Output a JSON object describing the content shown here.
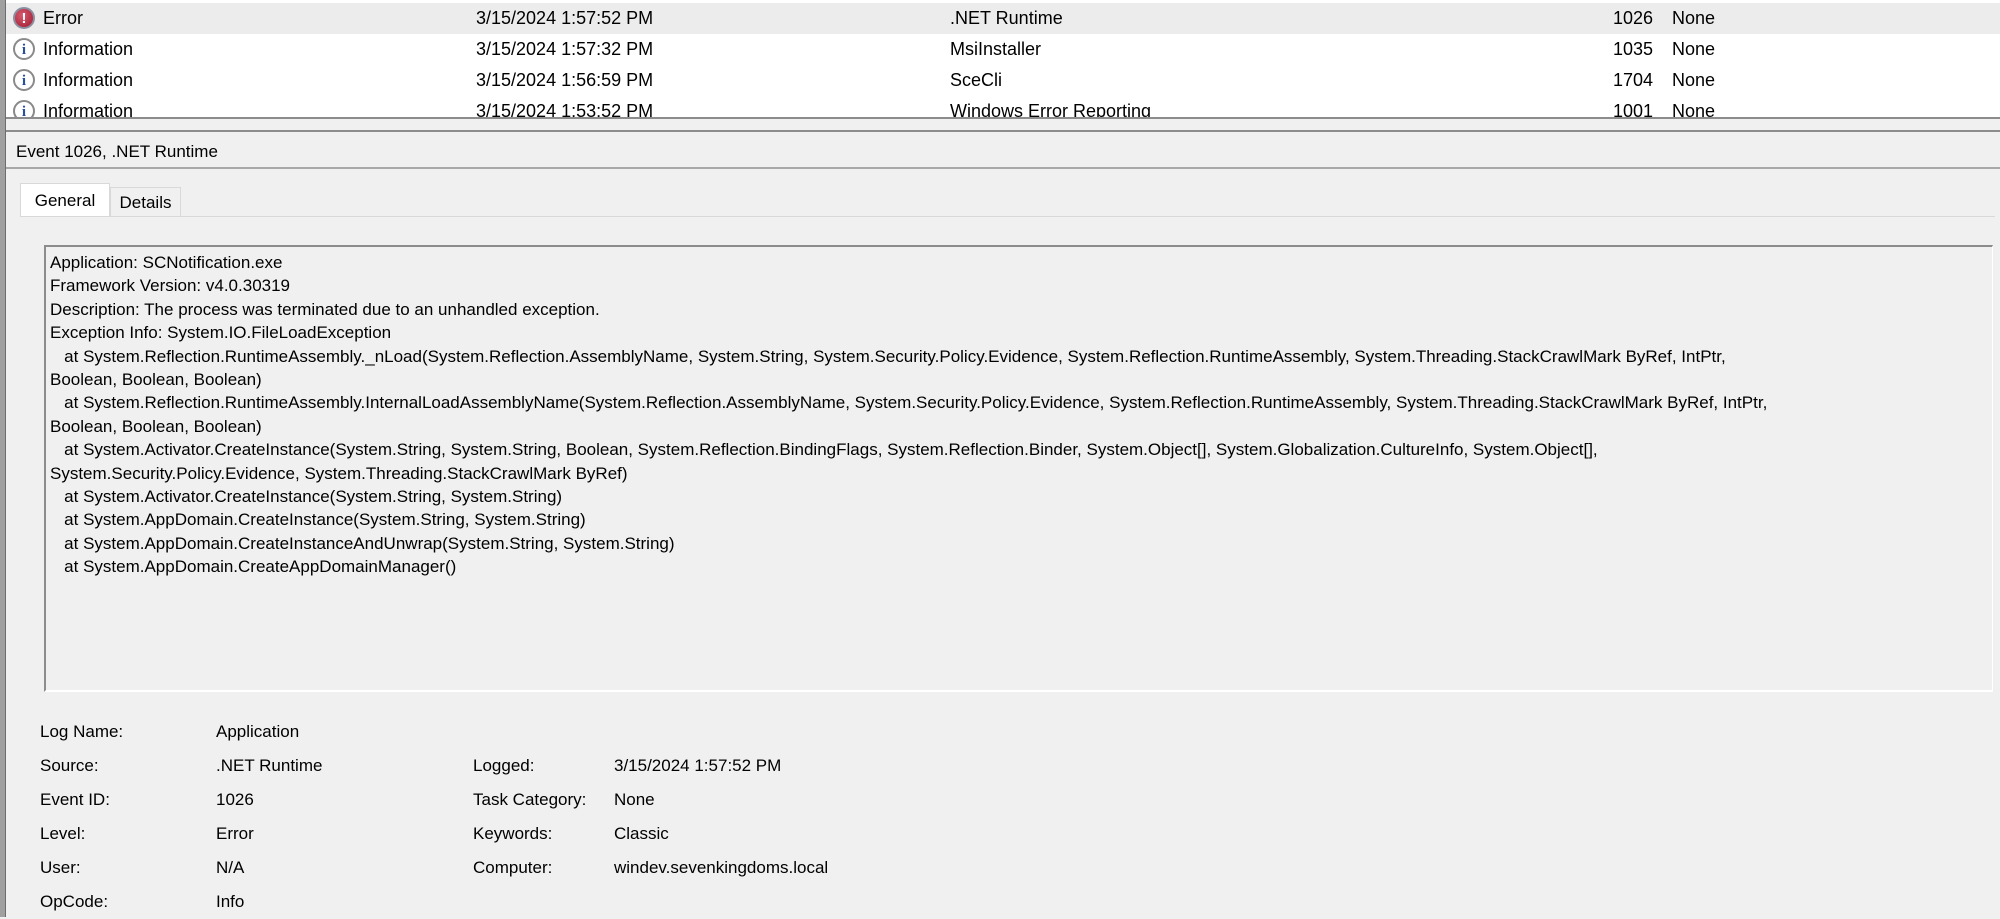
{
  "events": [
    {
      "level": "Error",
      "icon": "error-icon",
      "date": "3/15/2024 1:57:52 PM",
      "source": ".NET Runtime",
      "event_id": "1026",
      "task": "None",
      "selected": true
    },
    {
      "level": "Information",
      "icon": "info-icon",
      "date": "3/15/2024 1:57:32 PM",
      "source": "MsiInstaller",
      "event_id": "1035",
      "task": "None"
    },
    {
      "level": "Information",
      "icon": "info-icon",
      "date": "3/15/2024 1:56:59 PM",
      "source": "SceCli",
      "event_id": "1704",
      "task": "None"
    },
    {
      "level": "Information",
      "icon": "info-icon",
      "date": "3/15/2024 1:53:52 PM",
      "source": "Windows Error Reporting",
      "event_id": "1001",
      "task": "None"
    }
  ],
  "detail": {
    "title": "Event 1026, .NET Runtime",
    "tabs": [
      "General",
      "Details"
    ],
    "active_tab": "General",
    "message_lines": [
      "Application: SCNotification.exe",
      "Framework Version: v4.0.30319",
      "Description: The process was terminated due to an unhandled exception.",
      "Exception Info: System.IO.FileLoadException",
      "   at System.Reflection.RuntimeAssembly._nLoad(System.Reflection.AssemblyName, System.String, System.Security.Policy.Evidence, System.Reflection.RuntimeAssembly, System.Threading.StackCrawlMark ByRef, IntPtr,",
      "Boolean, Boolean, Boolean)",
      "   at System.Reflection.RuntimeAssembly.InternalLoadAssemblyName(System.Reflection.AssemblyName, System.Security.Policy.Evidence, System.Reflection.RuntimeAssembly, System.Threading.StackCrawlMark ByRef, IntPtr,",
      "Boolean, Boolean, Boolean)",
      "   at System.Activator.CreateInstance(System.String, System.String, Boolean, System.Reflection.BindingFlags, System.Reflection.Binder, System.Object[], System.Globalization.CultureInfo, System.Object[],",
      "System.Security.Policy.Evidence, System.Threading.StackCrawlMark ByRef)",
      "   at System.Activator.CreateInstance(System.String, System.String)",
      "   at System.AppDomain.CreateInstance(System.String, System.String)",
      "   at System.AppDomain.CreateInstanceAndUnwrap(System.String, System.String)",
      "   at System.AppDomain.CreateAppDomainManager()"
    ],
    "fields": {
      "log_name_label": "Log Name:",
      "log_name": "Application",
      "source_label": "Source:",
      "source": ".NET Runtime",
      "logged_label": "Logged:",
      "logged": "3/15/2024 1:57:52 PM",
      "event_id_label": "Event ID:",
      "event_id": "1026",
      "task_category_label": "Task Category:",
      "task_category": "None",
      "level_label": "Level:",
      "level": "Error",
      "keywords_label": "Keywords:",
      "keywords": "Classic",
      "user_label": "User:",
      "user": "N/A",
      "computer_label": "Computer:",
      "computer": "windev.sevenkingdoms.local",
      "opcode_label": "OpCode:",
      "opcode": "Info"
    }
  }
}
